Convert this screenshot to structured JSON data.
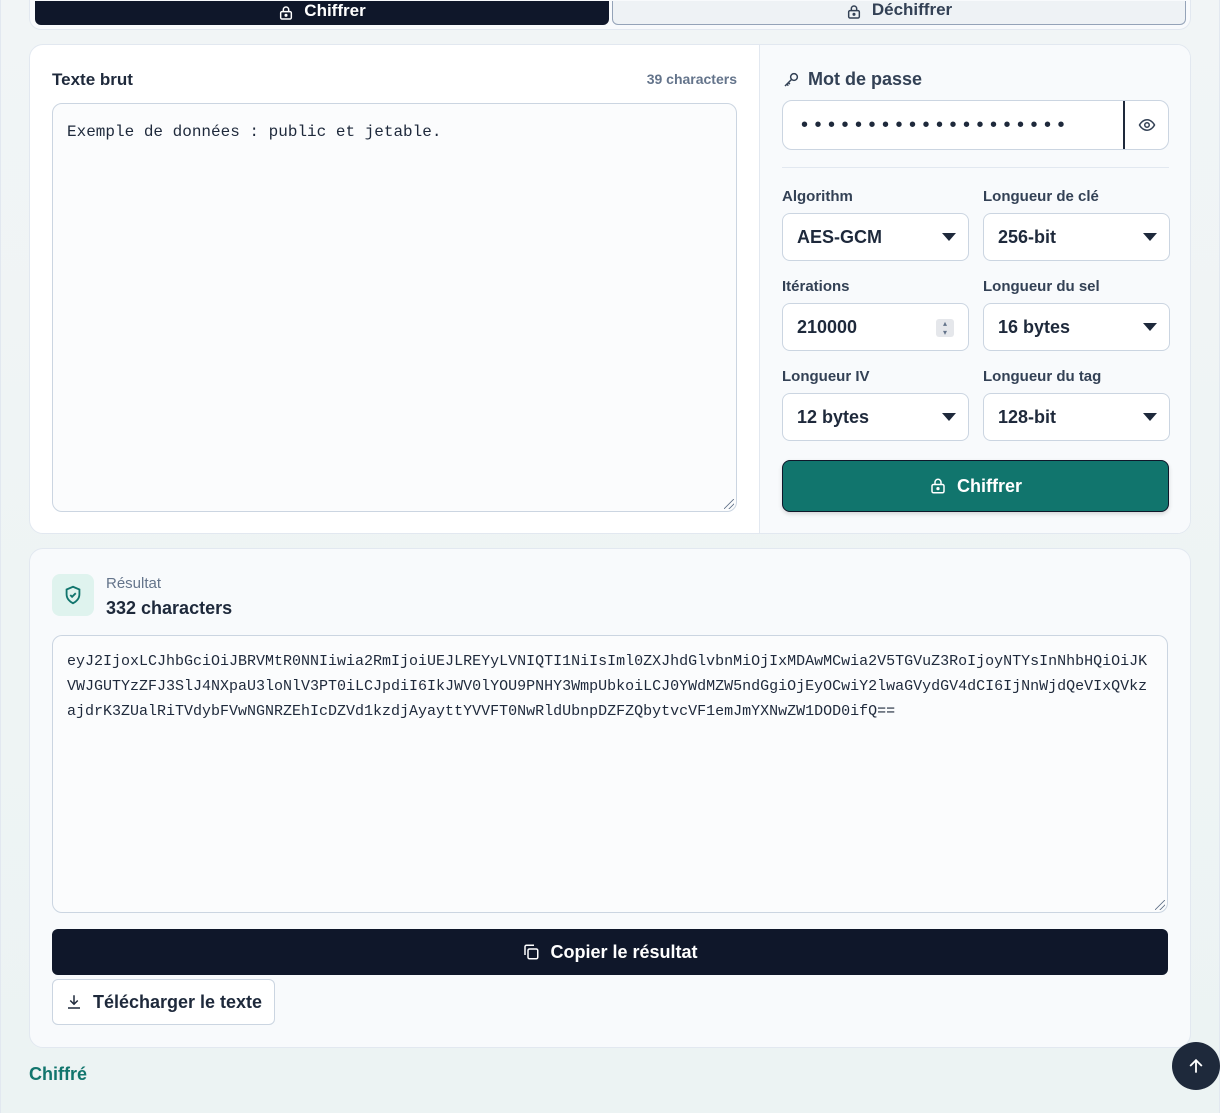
{
  "mode_tabs": {
    "encrypt_label": "Chiffrer",
    "decrypt_label": "Déchiffrer"
  },
  "input": {
    "title": "Texte brut",
    "char_count": "39 characters",
    "text": "Exemple de données : public et jetable."
  },
  "settings": {
    "password_label": "Mot de passe",
    "password_mask": "••••••••••••••••••••",
    "algorithm_label": "Algorithm",
    "algorithm_value": "AES-GCM",
    "key_length_label": "Longueur de clé",
    "key_length_value": "256-bit",
    "iterations_label": "Itérations",
    "iterations_value": "210000",
    "salt_length_label": "Longueur du sel",
    "salt_length_value": "16 bytes",
    "iv_length_label": "Longueur IV",
    "iv_length_value": "12 bytes",
    "tag_length_label": "Longueur du tag",
    "tag_length_value": "128-bit",
    "encrypt_button": "Chiffrer"
  },
  "result": {
    "label": "Résultat",
    "char_count": "332 characters",
    "text": "eyJ2IjoxLCJhbGciOiJBRVMtR0NNIiwia2RmIjoiUEJLREYyLVNIQTI1NiIsIml0ZXJhdGlvbnMiOjIxMDAwMCwia2V5TGVuZ3RoIjoyNTYsInNhbHQiOiJKVWJGUTYzZFJ3SlJ4NXpaU3loNlV3PT0iLCJpdiI6IkJWV0lYOU9PNHY3WmpUbkoiLCJ0YWdMZW5ndGgiOjEyOCwiY2lwaGVydGV4dCI6IjNnWjdQeVIxQVkzajdrK3ZUalRiTVdybFVwNGNRZEhIcDZVd1kzdjAyayttYVVFT0NwRldUbnpDZFZQbytvcVF1emJmYXNwZW1DOD0ifQ==",
    "copy_button": "Copier le résultat",
    "download_button": "Télécharger le texte"
  },
  "status": "Chiffré",
  "colors": {
    "accent": "#11756d",
    "dark": "#0f172a"
  }
}
